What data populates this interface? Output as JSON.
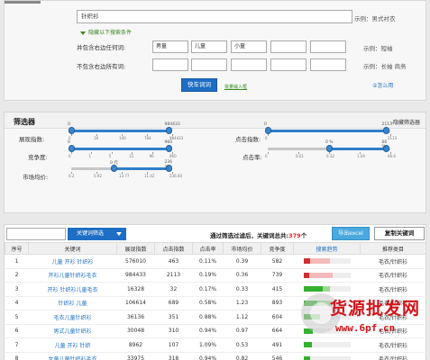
{
  "search": {
    "main_value": "针织衫",
    "main_example": "示例：男式衬衣",
    "toggle_label": "隐藏以下搜索条件",
    "include_label": "并包含右边任何词:",
    "include_words": [
      "男童",
      "儿童",
      "小童",
      "",
      ""
    ],
    "include_example": "示例：短袖",
    "exclude_label": "不包含右边所有词:",
    "exclude_words": [
      "",
      "",
      "",
      "",
      ""
    ],
    "exclude_example": "示例：长袖 商务",
    "search_button": "快车词词",
    "more_link": "批量输入框",
    "help_link": "②怎么用"
  },
  "filter": {
    "title": "筛选器",
    "hide_label": "-隐藏筛选器",
    "sliders": [
      {
        "label": "展现指数:",
        "min_val": "0",
        "max_val": "984433",
        "ticks": [
          "0",
          "18",
          "140",
          "784",
          "984433"
        ],
        "lo": 0,
        "hi": 0.96
      },
      {
        "label": "点击指数:",
        "min_val": "0",
        "max_val": "2113",
        "ticks": [
          "0",
          "2113"
        ],
        "lo": 0,
        "hi": 0.96
      },
      {
        "label": "竞争度:",
        "min_val": "0",
        "max_val": "960",
        "ticks": [
          "0",
          "1",
          "5",
          "21",
          "96",
          "960"
        ],
        "lo": 0,
        "hi": 0.96
      },
      {
        "label": "点击率:",
        "min_val": "0 %",
        "max_val": "66 %",
        "ticks": [
          "0",
          "0.01",
          "0.32",
          "1.04",
          "66.6"
        ],
        "lo": 0.5,
        "hi": 0.96
      },
      {
        "label": "市场均价:",
        "min_val": "0 元",
        "max_val": "236 元",
        "ticks": [
          "0.2",
          "0.92",
          "13.77",
          "11.42",
          "236.00"
        ],
        "lo": 0.42,
        "hi": 0.96
      }
    ]
  },
  "table": {
    "filter_button": "关键词筛选",
    "summary_prefix": "通过筛选过滤后，关键词总共:",
    "summary_count": "379",
    "summary_suffix": "个",
    "export_button": "导出excel",
    "copy_button": "复制关键词",
    "headers": [
      "序号",
      "关键词",
      "展现指数",
      "点击指数",
      "点击率",
      "市场均价",
      "竞争度",
      "搜索趋势",
      "推荐类目"
    ],
    "rows": [
      {
        "no": "1",
        "kw": "儿童 开衫 针织衫",
        "show": "576010",
        "click": "463",
        "ctr": "0.11%",
        "price": "0.39",
        "comp": "582",
        "trend": [
          0.14,
          0.42
        ],
        "color": "red",
        "cat": "毛衣/针织衫"
      },
      {
        "no": "2",
        "kw": "开衫儿童针织衫毛衣",
        "show": "984433",
        "click": "2113",
        "ctr": "0.19%",
        "price": "0.36",
        "comp": "739",
        "trend": [
          0.12,
          0.5
        ],
        "color": "red",
        "cat": "毛衣/针织衫"
      },
      {
        "no": "3",
        "kw": "开衫 针织衫儿童毛衣",
        "show": "16328",
        "click": "32",
        "ctr": "0.17%",
        "price": "0.33",
        "comp": "415",
        "trend": [
          0.42,
          0.15
        ],
        "color": "green",
        "cat": "毛衣/针织衫"
      },
      {
        "no": "4",
        "kw": "针织衫 儿童",
        "show": "106614",
        "click": "689",
        "ctr": "0.58%",
        "price": "1.23",
        "comp": "893",
        "trend": [
          0.3,
          0.3
        ],
        "color": "green",
        "cat": "毛衣/针织衫"
      },
      {
        "no": "5",
        "kw": "毛衣儿童针织衫",
        "show": "36136",
        "click": "351",
        "ctr": "0.88%",
        "price": "1.12",
        "comp": "604",
        "trend": [
          0.35,
          0.0
        ],
        "color": "green",
        "cat": "毛衣/针织衫"
      },
      {
        "no": "6",
        "kw": "男式儿童针织衫",
        "show": "30048",
        "click": "310",
        "ctr": "0.94%",
        "price": "0.97",
        "comp": "664",
        "trend": [
          0.2,
          0.0
        ],
        "color": "green",
        "cat": "毛衣/针织衫"
      },
      {
        "no": "7",
        "kw": "儿童 开衫 针织",
        "show": "8962",
        "click": "107",
        "ctr": "1.09%",
        "price": "0.53",
        "comp": "491",
        "trend": [
          0.18,
          0.0
        ],
        "color": "green",
        "cat": "毛衣/针织衫"
      },
      {
        "no": "8",
        "kw": "女童儿童针织衫毛衣",
        "show": "33975",
        "click": "318",
        "ctr": "0.94%",
        "price": "0.82",
        "comp": "546",
        "trend": [
          0.15,
          0.0
        ],
        "color": "green",
        "cat": "毛衣/针织衫"
      }
    ]
  },
  "watermark": {
    "line1": "货源批发网",
    "line2": "www.6pf.cn"
  }
}
